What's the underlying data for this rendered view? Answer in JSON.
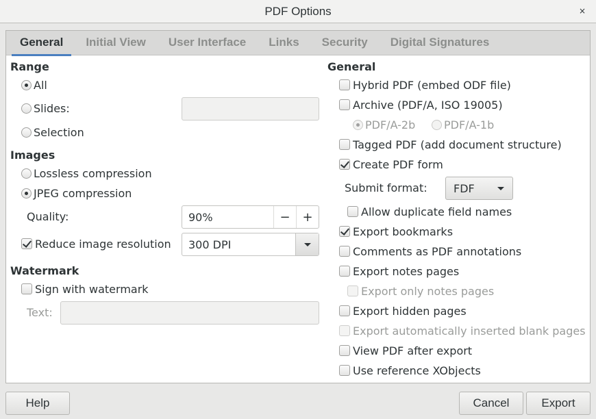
{
  "window": {
    "title": "PDF Options",
    "close_glyph": "×"
  },
  "tabs": [
    {
      "label": "General",
      "active": true
    },
    {
      "label": "Initial View",
      "active": false
    },
    {
      "label": "User Interface",
      "active": false
    },
    {
      "label": "Links",
      "active": false
    },
    {
      "label": "Security",
      "active": false
    },
    {
      "label": "Digital Signatures",
      "active": false
    }
  ],
  "range": {
    "title": "Range",
    "all_label": "All",
    "all_selected": true,
    "slides_label": "Slides:",
    "slides_value": "",
    "selection_label": "Selection"
  },
  "images": {
    "title": "Images",
    "lossless_label": "Lossless compression",
    "jpeg_label": "JPEG compression",
    "jpeg_selected": true,
    "quality_label": "Quality:",
    "quality_value": "90%",
    "decrement_glyph": "−",
    "increment_glyph": "+",
    "reduce_label": "Reduce image resolution",
    "reduce_checked": true,
    "resolution_value": "300 DPI"
  },
  "watermark": {
    "title": "Watermark",
    "sign_label": "Sign with watermark",
    "sign_checked": false,
    "text_label": "Text:",
    "text_value": ""
  },
  "general": {
    "title": "General",
    "hybrid_label": "Hybrid PDF (embed ODF file)",
    "archive_label": "Archive (PDF/A, ISO 19005)",
    "pdfa2b_label": "PDF/A-2b",
    "pdfa1b_label": "PDF/A-1b",
    "tagged_label": "Tagged PDF (add document structure)",
    "create_form_label": "Create PDF form",
    "create_form_checked": true,
    "submit_format_label": "Submit format:",
    "submit_format_value": "FDF",
    "allow_duplicate_label": "Allow duplicate field names",
    "export_bookmarks_label": "Export bookmarks",
    "export_bookmarks_checked": true,
    "comments_label": "Comments as PDF annotations",
    "export_notes_label": "Export notes pages",
    "export_only_notes_label": "Export only notes pages",
    "export_hidden_label": "Export hidden pages",
    "export_blank_label": "Export automatically inserted blank pages",
    "view_after_label": "View PDF after export",
    "reference_xobjects_label": "Use reference XObjects"
  },
  "footer": {
    "help_label": "Help",
    "cancel_label": "Cancel",
    "export_label": "Export"
  }
}
